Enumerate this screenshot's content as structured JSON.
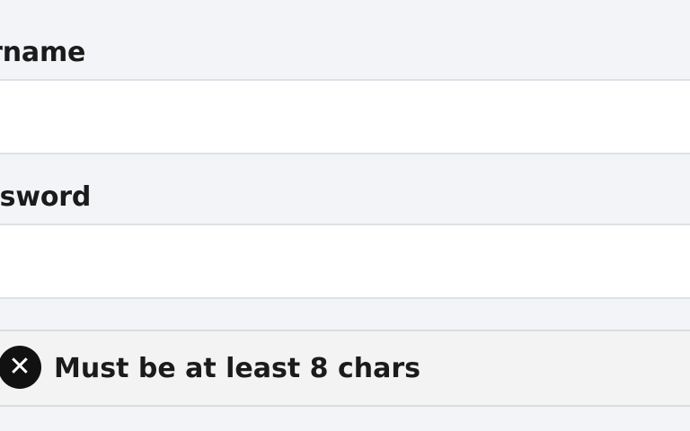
{
  "form": {
    "username_label": "ername",
    "username_value": "",
    "password_label": "ssword",
    "password_value": ""
  },
  "validation": {
    "icon": "close-circle-icon",
    "icon_glyph": "✕",
    "message": "Must be at least 8 chars"
  }
}
